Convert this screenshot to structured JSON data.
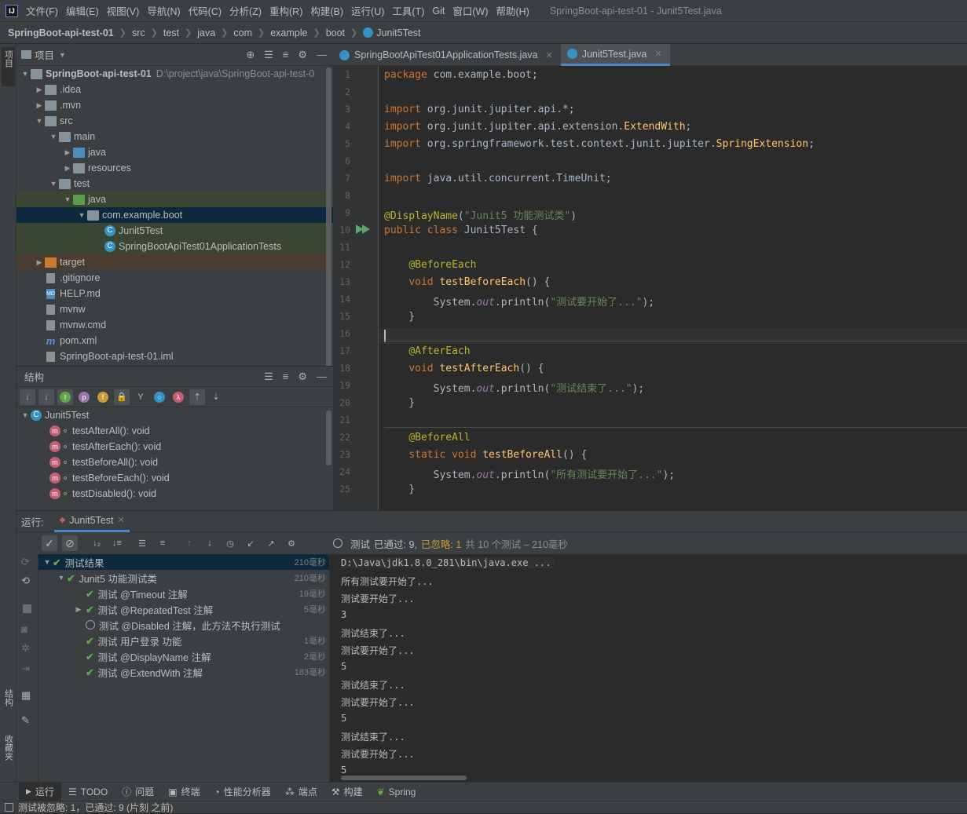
{
  "menubar": {
    "items": [
      "文件(F)",
      "编辑(E)",
      "视图(V)",
      "导航(N)",
      "代码(C)",
      "分析(Z)",
      "重构(R)",
      "构建(B)",
      "运行(U)",
      "工具(T)",
      "Git",
      "窗口(W)",
      "帮助(H)"
    ],
    "window_title": "SpringBoot-api-test-01 - Junit5Test.java"
  },
  "breadcrumb": [
    "SpringBoot-api-test-01",
    "src",
    "test",
    "java",
    "com",
    "example",
    "boot",
    "Junit5Test"
  ],
  "left_stripe": {
    "project": "项目",
    "structure": "结构",
    "favorites": "收藏夹"
  },
  "project_panel": {
    "title": "项目",
    "root": "SpringBoot-api-test-01",
    "root_path": "D:\\project\\java\\SpringBoot-api-test-0",
    "nodes": [
      ".idea",
      ".mvn",
      "src",
      "main",
      "java",
      "resources",
      "test",
      "java",
      "com.example.boot",
      "Junit5Test",
      "SpringBootApiTest01ApplicationTests",
      "target",
      ".gitignore",
      "HELP.md",
      "mvnw",
      "mvnw.cmd",
      "pom.xml",
      "SpringBoot-api-test-01.iml"
    ]
  },
  "structure_panel": {
    "title": "结构",
    "class_name": "Junit5Test",
    "members": [
      "testAfterAll(): void",
      "testAfterEach(): void",
      "testBeforeAll(): void",
      "testBeforeEach(): void",
      "testDisabled(): void"
    ]
  },
  "editor": {
    "tabs": [
      "SpringBootApiTest01ApplicationTests.java",
      "Junit5Test.java"
    ],
    "line_numbers": [
      "1",
      "2",
      "3",
      "4",
      "5",
      "6",
      "7",
      "8",
      "9",
      "10",
      "11",
      "12",
      "13",
      "14",
      "15",
      "16",
      "17",
      "18",
      "19",
      "20",
      "21",
      "22",
      "23",
      "24",
      "25"
    ]
  },
  "run": {
    "label": "运行:",
    "tab": "Junit5Test",
    "status": {
      "prefix": "测试",
      "passed": "已通过: 9,",
      "ignored": "已忽略: 1",
      "total": "共 10 个测试 – 210毫秒"
    },
    "tree": [
      {
        "label": "测试结果",
        "dur": "210毫秒"
      },
      {
        "label": "Junit5 功能测试类",
        "dur": "210毫秒"
      },
      {
        "label": "测试 @Timeout 注解",
        "dur": "19毫秒"
      },
      {
        "label": "测试 @RepeatedTest 注解",
        "dur": "5毫秒"
      },
      {
        "label": "测试 @Disabled 注解，此方法不执行测试",
        "dur": ""
      },
      {
        "label": "测试 用户登录 功能",
        "dur": "1毫秒"
      },
      {
        "label": "测试 @DisplayName 注解",
        "dur": "2毫秒"
      },
      {
        "label": "测试 @ExtendWith 注解",
        "dur": "183毫秒"
      }
    ],
    "console": [
      "D:\\Java\\jdk1.8.0_281\\bin\\java.exe ...",
      "所有测试要开始了...",
      "测试要开始了...",
      "3",
      "测试结束了...",
      "测试要开始了...",
      "5",
      "测试结束了...",
      "测试要开始了...",
      "5",
      "测试结束了...",
      "测试要开始了...",
      "5"
    ]
  },
  "bottom_tabs": [
    "运行",
    "TODO",
    "问题",
    "终端",
    "性能分析器",
    "端点",
    "构建",
    "Spring"
  ],
  "statusbar": "测试被忽略: 1，已通过: 9 (片刻 之前)",
  "colors": {
    "accent": "#4a88c7",
    "pass": "#5fa84a",
    "keyword": "#cc7832",
    "string": "#6a8759",
    "annotation": "#bbb529"
  }
}
